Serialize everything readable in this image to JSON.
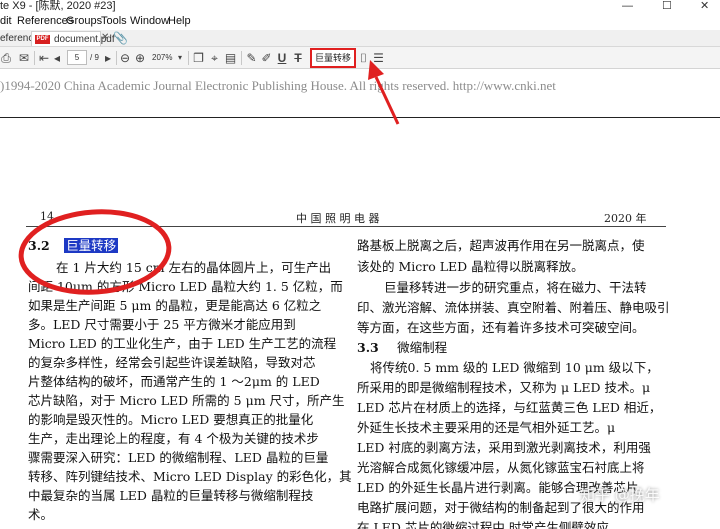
{
  "window": {
    "title": "te X9 - [陈默, 2020 #23]",
    "controls": [
      "—",
      "☐",
      "✕"
    ]
  },
  "menu": [
    "dit",
    "References",
    "Groups",
    "Tools",
    "Window",
    "Help"
  ],
  "tabs": {
    "left_partial": "eference",
    "document": "document.pdf",
    "pdf_badge": "PDF"
  },
  "toolbar": {
    "page_current": "5",
    "page_total": "/ 9",
    "zoom": "207%",
    "highlighted_button": "巨量转移"
  },
  "document": {
    "watermark": ")1994-2020 China Academic Journal Electronic Publishing House. All rights reserved.    http://www.cnki.net",
    "page_number": "14",
    "journal": "中 国 照 明 电 器",
    "year": "2020 年",
    "left_column": {
      "section_num": "3.2",
      "section_title": "巨量转移",
      "lines": [
        "在 1 片大约 15 cm 左右的晶体圆片上，可生产出",
        "间距 10μm 的方形 Micro LED 晶粒大约 1. 5 亿粒，而",
        "如果是生产间距 5 μm 的晶粒，更是能高达 6 亿粒之",
        "多。LED 尺寸需要小于 25 平方微米才能应用到",
        "Micro LED 的工业化生产，由于 LED 生产工艺的流程",
        "的复杂多样性，经常会引起些许误差缺陷，导致对芯",
        "片整体结构的破坏，而通常产生的 1 ～2μm 的 LED",
        "芯片缺陷，对于 Micro LED 所需的 5 μm 尺寸，所产生",
        "的影响是毁灭性的。Micro LED 要想真正的批量化",
        "生产，走出理论上的程度，有 4 个极为关键的技术步",
        "骤需要深入研究：LED 的微缩制程、LED 晶粒的巨量",
        "转移、阵列键结技术、Micro LED Display 的彩色化，其",
        "中最复杂的当属 LED 晶粒的巨量转移与微缩制程技",
        "术。"
      ]
    },
    "right_column": {
      "section_num": "3.3",
      "section_title": "微缩制程",
      "lines_before": [
        "路基板上脱离之后，超声波再作用在另一脱离点，使",
        "该处的 Micro LED 晶粒得以脱离释放。",
        "巨量移转进一步的研究重点，将在磁力、干法转",
        "印、激光溶解、流体拼装、真空附着、附着压、静电吸引",
        "等方面，在这些方面，还有着许多技术可突破空间。"
      ],
      "lines_after": [
        "将传统0. 5 mm 级的 LED 微缩到 10 μm 级以下，",
        "所采用的即是微缩制程技术，又称为 μ LED 技术。μ",
        "LED 芯片在材质上的选择，与红蓝黄三色 LED 相近，",
        "外延生长技术主要采用的还是气相外延工艺。μ",
        "LED 衬底的剥离方法，采用到激光剥离技术，利用强",
        "光溶解合成氮化镓缓冲层，从氮化镓蓝宝石衬底上将",
        "LED 的外延生长晶片进行剥离。能够合理改善芯片",
        "电路扩展问题，对于微结构的制备起到了很大的作用",
        "在 LED 芯片的微缩过程中 时常产生侧壁效应"
      ]
    },
    "zhihu_mark": "知乎 @挽年"
  },
  "colors": {
    "annotation_red": "#e02020",
    "selection_blue": "#1d39c4"
  }
}
